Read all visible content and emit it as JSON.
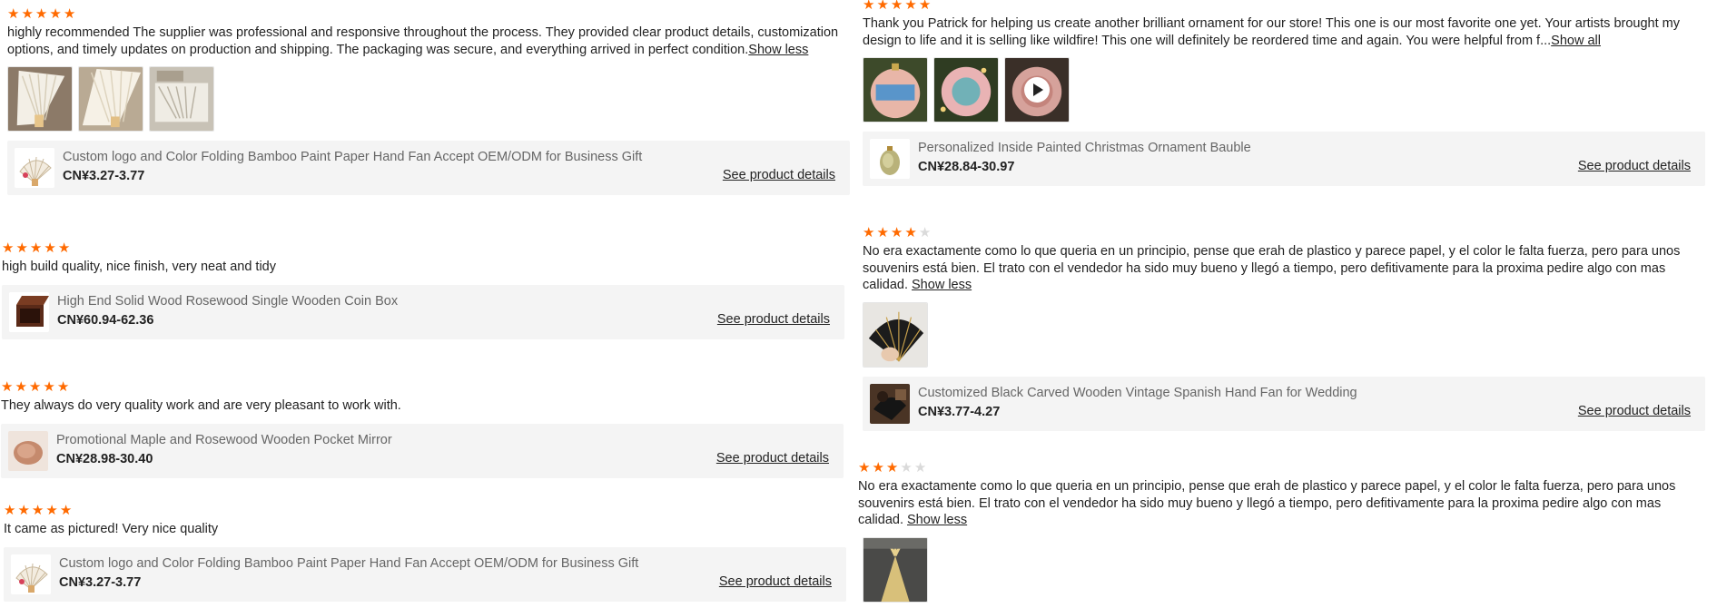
{
  "colors": {
    "star": "#ff6a00",
    "star_empty": "#dadada",
    "card_bg": "#f4f4f4"
  },
  "link_label": "See product details",
  "reviews": [
    {
      "rating": 5,
      "text": "highly recommended The supplier was professional and responsive throughout the process. They provided clear product details, customization options, and timely updates on production and shipping. The packaging was secure, and everything arrived in perfect condition.",
      "toggle": "Show less",
      "images": [
        "fan-image",
        "fan-image",
        "fan-image"
      ],
      "product": {
        "name": "Custom logo and Color Folding Bamboo Paint Paper Hand Fan Accept OEM/ODM for Business Gift",
        "price": "CN¥3.27-3.77",
        "image": "fan-image"
      }
    },
    {
      "rating": 5,
      "text": "high build quality, nice finish, very neat and tidy",
      "product": {
        "name": "High End Solid Wood Rosewood Single Wooden Coin Box",
        "price": "CN¥60.94-62.36",
        "image": "wooden-box-image"
      }
    },
    {
      "rating": 5,
      "text": "They always do very quality work and are very pleasant to work with.",
      "product": {
        "name": "Promotional Maple and Rosewood Wooden Pocket Mirror",
        "price": "CN¥28.98-30.40",
        "image": "pocket-mirror-image"
      }
    },
    {
      "rating": 5,
      "text": "It came as pictured! Very nice quality",
      "product": {
        "name": "Custom logo and Color Folding Bamboo Paint Paper Hand Fan Accept OEM/ODM for Business Gift",
        "price": "CN¥3.27-3.77",
        "image": "fan-image"
      }
    },
    {
      "rating": 5,
      "text": "Thank you Patrick for helping us create another brilliant ornament for our store! This one is our most favorite one yet. Your artists brought my design to life and it is selling like wildfire! This one will definitely be reordered time and again. You were helpful from f...",
      "toggle": "Show all",
      "images": [
        "ornament-image",
        "ornament-image",
        "ornament-video"
      ],
      "product": {
        "name": "Personalized Inside Painted Christmas Ornament Bauble",
        "price": "CN¥28.84-30.97",
        "image": "ornament-image"
      }
    },
    {
      "rating": 4,
      "text": "No era exactamente como lo que queria en un principio, pense que erah de plastico y parece papel, y el color le falta fuerza, pero para unos souvenirs está bien. El trato con el vendedor ha sido muy bueno y llegó a tiempo, pero defitivamente para la proxima pedire algo con mas calidad.",
      "toggle": "Show less",
      "images": [
        "black-fan-image"
      ],
      "product": {
        "name": "Customized Black Carved Wooden Vintage Spanish Hand Fan for Wedding",
        "price": "CN¥3.77-4.27",
        "image": "black-fan-image"
      }
    },
    {
      "rating": 3,
      "text": "No era exactamente como lo que queria en un principio, pense que erah de plastico y parece papel, y el color le falta fuerza, pero para unos souvenirs está bien. El trato con el vendedor ha sido muy bueno y llegó a tiempo, pero defitivamente para la proxima pedire algo con mas calidad.",
      "toggle": "Show less",
      "images": [
        "gold-fan-image"
      ]
    }
  ]
}
